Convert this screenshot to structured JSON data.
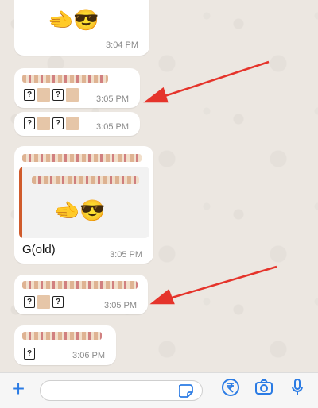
{
  "messages": [
    {
      "time": "3:04 PM",
      "emoji": "🫲😎"
    },
    {
      "time": "3:05 PM"
    },
    {
      "time": "3:05 PM"
    },
    {
      "time": "3:05 PM",
      "quote_emoji": "🫲😎",
      "text": "G(old)"
    },
    {
      "time": "3:05 PM"
    },
    {
      "time": "3:06 PM"
    }
  ],
  "glyphs": {
    "qmark": "?"
  },
  "colors": {
    "accent": "#2a7be4",
    "arrow": "#e5342b",
    "quote_bar": "#d05b2c"
  },
  "icons": [
    "plus-icon",
    "sticker-icon",
    "rupee-icon",
    "camera-icon",
    "mic-icon"
  ]
}
